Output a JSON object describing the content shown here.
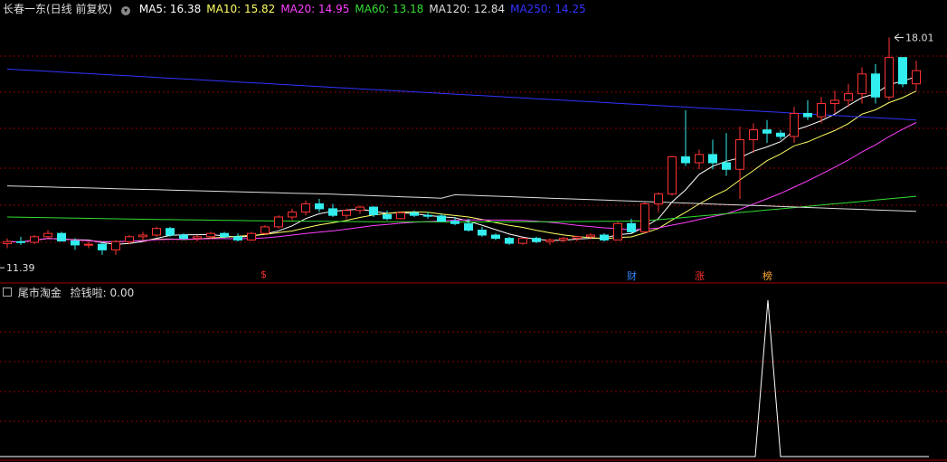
{
  "main_header": {
    "title": "长春一东(日线 前复权)",
    "ma": [
      {
        "label": "MA5: 16.38",
        "color": "#ffffff"
      },
      {
        "label": "MA10: 15.82",
        "color": "#ffff66"
      },
      {
        "label": "MA20: 14.95",
        "color": "#ff40ff"
      },
      {
        "label": "MA60: 13.18",
        "color": "#33dd33"
      },
      {
        "label": "MA120: 12.84",
        "color": "#dddddd"
      },
      {
        "label": "MA250: 14.25",
        "color": "#3333ff"
      }
    ]
  },
  "annotations": {
    "high_label": "18.01",
    "low_label": "11.39"
  },
  "markers": [
    {
      "label": "$",
      "color": "#ff3030"
    },
    {
      "label": "财",
      "color": "#3388ff"
    },
    {
      "label": "涨",
      "color": "#ff3030"
    },
    {
      "label": "榜",
      "color": "#ffaa33"
    }
  ],
  "sub_header": {
    "title": "尾市淘金",
    "indicator": "捡钱啦: 0.00"
  },
  "colors": {
    "up": "#ff3333",
    "down": "#33eeee",
    "grid": "#8b0000",
    "frame": "#a00000"
  },
  "chart_data": {
    "type": "candlestick",
    "price_range": [
      10.9,
      18.6
    ],
    "high": 18.01,
    "low": 11.39,
    "candles": [
      [
        11.74,
        11.9,
        11.6,
        11.8
      ],
      [
        11.8,
        11.95,
        11.7,
        11.78
      ],
      [
        11.78,
        12.0,
        11.72,
        11.95
      ],
      [
        11.95,
        12.15,
        11.9,
        12.05
      ],
      [
        12.05,
        12.1,
        11.8,
        11.82
      ],
      [
        11.82,
        11.9,
        11.55,
        11.7
      ],
      [
        11.7,
        11.8,
        11.6,
        11.72
      ],
      [
        11.72,
        11.78,
        11.4,
        11.55
      ],
      [
        11.55,
        11.85,
        11.4,
        11.8
      ],
      [
        11.8,
        12.0,
        11.72,
        11.95
      ],
      [
        11.95,
        12.1,
        11.85,
        12.0
      ],
      [
        12.0,
        12.25,
        11.95,
        12.2
      ],
      [
        12.2,
        12.25,
        11.95,
        12.0
      ],
      [
        12.0,
        12.05,
        11.85,
        11.9
      ],
      [
        11.9,
        12.0,
        11.8,
        11.95
      ],
      [
        11.95,
        12.1,
        11.88,
        12.05
      ],
      [
        12.05,
        12.1,
        11.9,
        11.95
      ],
      [
        11.95,
        12.05,
        11.8,
        11.85
      ],
      [
        11.85,
        12.1,
        11.82,
        12.05
      ],
      [
        12.05,
        12.3,
        12.0,
        12.25
      ],
      [
        12.25,
        12.6,
        12.2,
        12.55
      ],
      [
        12.55,
        12.8,
        12.45,
        12.7
      ],
      [
        12.7,
        13.05,
        12.6,
        12.95
      ],
      [
        12.95,
        13.1,
        12.7,
        12.8
      ],
      [
        12.8,
        12.95,
        12.55,
        12.6
      ],
      [
        12.6,
        12.8,
        12.5,
        12.75
      ],
      [
        12.75,
        12.9,
        12.65,
        12.85
      ],
      [
        12.85,
        12.88,
        12.55,
        12.62
      ],
      [
        12.62,
        12.75,
        12.45,
        12.5
      ],
      [
        12.5,
        12.72,
        12.48,
        12.68
      ],
      [
        12.68,
        12.75,
        12.55,
        12.6
      ],
      [
        12.6,
        12.7,
        12.5,
        12.58
      ],
      [
        12.58,
        12.65,
        12.4,
        12.42
      ],
      [
        12.42,
        12.55,
        12.3,
        12.35
      ],
      [
        12.35,
        12.5,
        12.1,
        12.15
      ],
      [
        12.15,
        12.25,
        11.95,
        12.0
      ],
      [
        12.0,
        12.05,
        11.85,
        11.9
      ],
      [
        11.9,
        11.95,
        11.7,
        11.75
      ],
      [
        11.75,
        11.92,
        11.7,
        11.9
      ],
      [
        11.9,
        11.95,
        11.75,
        11.8
      ],
      [
        11.8,
        11.9,
        11.7,
        11.85
      ],
      [
        11.85,
        11.95,
        11.78,
        11.9
      ],
      [
        11.9,
        11.98,
        11.8,
        11.95
      ],
      [
        11.95,
        12.05,
        11.88,
        12.0
      ],
      [
        12.0,
        12.05,
        11.8,
        11.85
      ],
      [
        11.85,
        12.4,
        11.85,
        12.35
      ],
      [
        12.35,
        12.5,
        12.05,
        12.1
      ],
      [
        12.1,
        13.0,
        12.05,
        12.95
      ],
      [
        12.95,
        13.3,
        12.7,
        13.25
      ],
      [
        13.25,
        14.4,
        13.2,
        14.38
      ],
      [
        14.38,
        15.8,
        14.1,
        14.2
      ],
      [
        14.2,
        14.6,
        14.0,
        14.45
      ],
      [
        14.45,
        14.9,
        14.0,
        14.2
      ],
      [
        14.2,
        15.1,
        13.8,
        14.0
      ],
      [
        14.0,
        15.3,
        13.1,
        14.9
      ],
      [
        14.9,
        15.4,
        14.5,
        15.2
      ],
      [
        15.2,
        15.5,
        14.8,
        15.1
      ],
      [
        15.1,
        15.2,
        14.9,
        15.0
      ],
      [
        15.0,
        15.9,
        14.8,
        15.7
      ],
      [
        15.7,
        16.1,
        15.5,
        15.6
      ],
      [
        15.6,
        16.2,
        15.4,
        16.0
      ],
      [
        16.0,
        16.4,
        15.7,
        16.1
      ],
      [
        16.1,
        16.6,
        15.9,
        16.3
      ],
      [
        16.3,
        17.1,
        16.0,
        16.9
      ],
      [
        16.9,
        17.2,
        16.0,
        16.2
      ],
      [
        16.2,
        18.01,
        16.1,
        17.4
      ],
      [
        17.4,
        17.3,
        16.5,
        16.6
      ],
      [
        16.6,
        17.3,
        16.4,
        17.0
      ]
    ],
    "ma_lines": [
      {
        "name": "MA5",
        "color": "#ffffff"
      },
      {
        "name": "MA10",
        "color": "#ffff66"
      },
      {
        "name": "MA20",
        "color": "#ff40ff"
      },
      {
        "name": "MA60",
        "color": "#33dd33"
      },
      {
        "name": "MA120",
        "color": "#dddddd"
      },
      {
        "name": "MA250",
        "color": "#3333ff"
      }
    ],
    "indicator": {
      "name": "捡钱啦",
      "spike_index": 56,
      "spike_value": 1,
      "range": [
        0,
        1
      ]
    }
  }
}
